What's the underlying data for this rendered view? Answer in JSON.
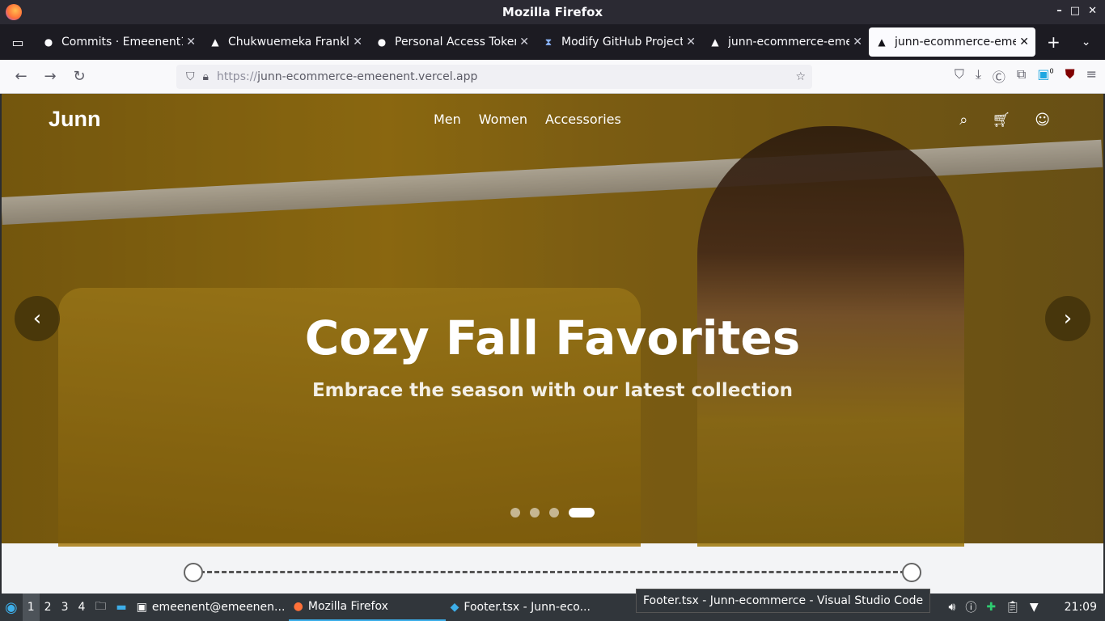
{
  "window": {
    "title": "Mozilla Firefox"
  },
  "tabs": [
    {
      "label": "Commits · Emeenent1",
      "icon": "github-icon"
    },
    {
      "label": "Chukwuemeka Franklin",
      "icon": "site-icon"
    },
    {
      "label": "Personal Access Token",
      "icon": "github-icon"
    },
    {
      "label": "Modify GitHub Project",
      "icon": "hourglass-icon"
    },
    {
      "label": "junn-ecommerce-emeenent",
      "icon": "vercel-icon"
    },
    {
      "label": "junn-ecommerce-emeenent",
      "icon": "vercel-icon",
      "active": true
    }
  ],
  "address": {
    "protocol": "https://",
    "host": "junn-ecommerce-emeenent.vercel.app"
  },
  "site": {
    "brand": "Junn",
    "nav": [
      "Men",
      "Women",
      "Accessories"
    ],
    "headline": "Cozy Fall Favorites",
    "subheadline": "Embrace the season with our latest collection",
    "carousel": {
      "slides": 4,
      "active_slide": 4
    },
    "prev_glyph": "‹",
    "next_glyph": "›"
  },
  "taskbar": {
    "workspaces": [
      "1",
      "2",
      "3",
      "4"
    ],
    "windows": [
      {
        "label": "emeenent@emeenen..."
      },
      {
        "label": "Mozilla Firefox",
        "active": true
      },
      {
        "label": "Footer.tsx - Junn-eco..."
      }
    ],
    "tooltip": "Footer.tsx - Junn-ecommerce - Visual Studio Code",
    "clock": "21:09",
    "extension_badge": "0"
  }
}
